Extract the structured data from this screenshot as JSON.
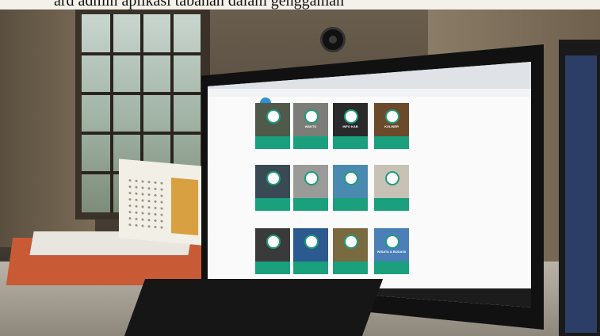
{
  "caption": {
    "text": "ard admin aplikasi tabanan dalam genggaman"
  },
  "screen": {
    "tiles": [
      {
        "label": "",
        "color": "#4f5a4a"
      },
      {
        "label": "WAKTU",
        "color": "#7c7c78"
      },
      {
        "label": "INFO KAB",
        "color": "#2a2a2a"
      },
      {
        "label": "KULINER",
        "color": "#6a4a2a"
      },
      {
        "label": "",
        "color": "#3a4a55"
      },
      {
        "label": "",
        "color": "#9a9a98"
      },
      {
        "label": "",
        "color": "#4a8ab0"
      },
      {
        "label": "",
        "color": "#c7c2b5"
      },
      {
        "label": "",
        "color": "#3a3a3a"
      },
      {
        "label": "",
        "color": "#2a5a90"
      },
      {
        "label": "",
        "color": "#7a6a40"
      },
      {
        "label": "WISATA & BUDAYA",
        "color": "#4a7fb8"
      }
    ]
  },
  "colors": {
    "tile_bar": "#1aa07d",
    "tile_icon_ring": "#1f9b7a",
    "logo": "#2f8fd0"
  }
}
